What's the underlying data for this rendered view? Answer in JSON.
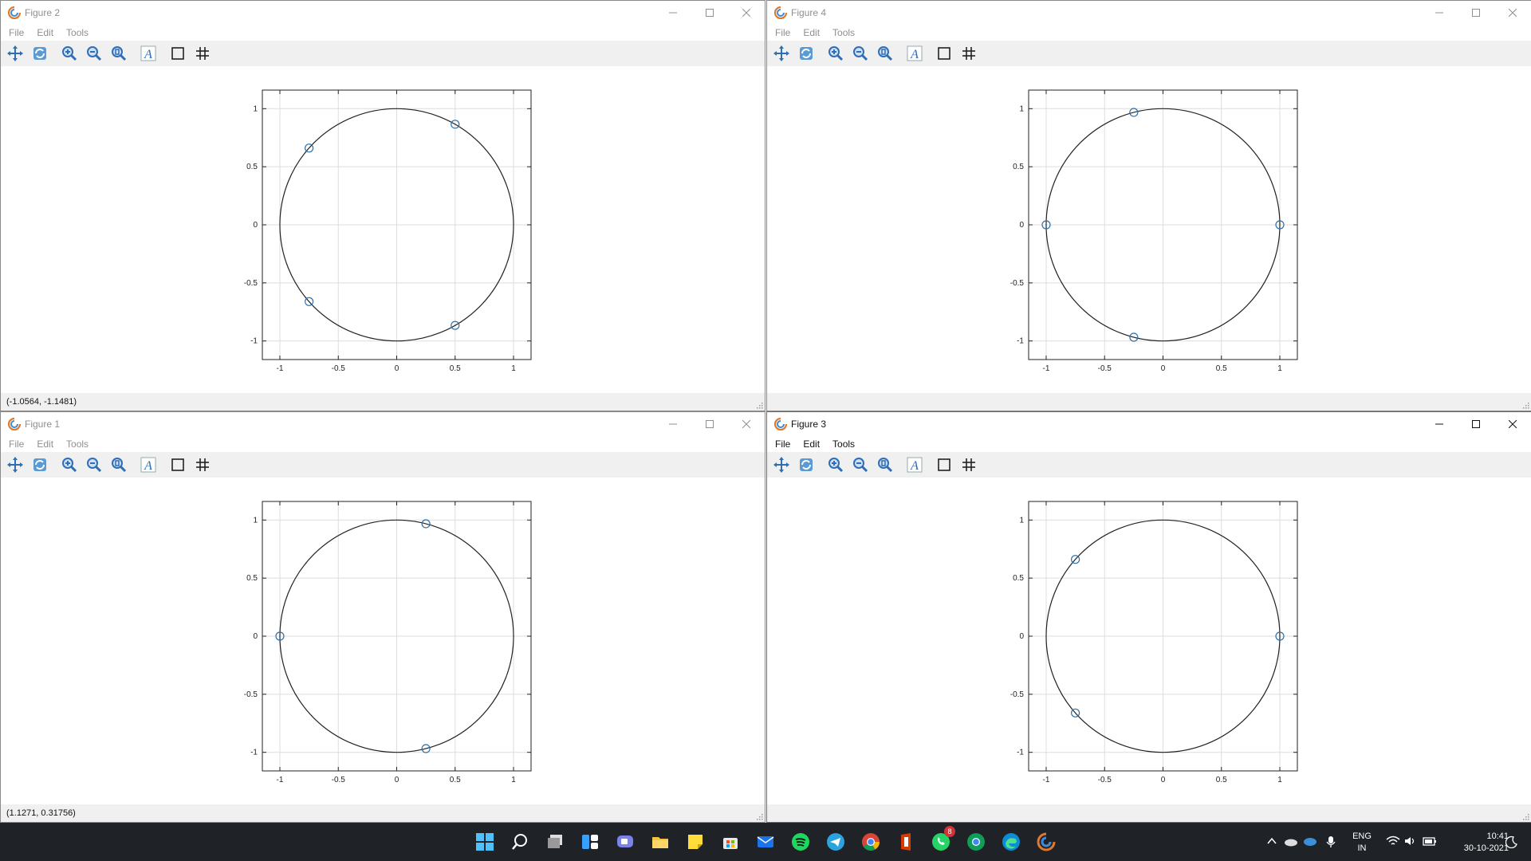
{
  "windows": [
    {
      "title": "Figure 2",
      "menus": [
        "File",
        "Edit",
        "Tools"
      ],
      "status": "(-1.0564, -1.1481)",
      "active": false,
      "points": [
        [
          0.5,
          0.866
        ],
        [
          -0.75,
          0.661
        ],
        [
          -0.75,
          -0.661
        ],
        [
          0.5,
          -0.866
        ]
      ]
    },
    {
      "title": "Figure 4",
      "menus": [
        "File",
        "Edit",
        "Tools"
      ],
      "status": "",
      "active": false,
      "points": [
        [
          -0.25,
          0.968
        ],
        [
          -1,
          0
        ],
        [
          1,
          0
        ],
        [
          -0.25,
          -0.968
        ]
      ]
    },
    {
      "title": "Figure 1",
      "menus": [
        "File",
        "Edit",
        "Tools"
      ],
      "status": "(1.1271, 0.31756)",
      "active": false,
      "points": [
        [
          0.25,
          0.968
        ],
        [
          -1,
          0
        ],
        [
          0.25,
          -0.968
        ]
      ]
    },
    {
      "title": "Figure 3",
      "menus": [
        "File",
        "Edit",
        "Tools"
      ],
      "status": "",
      "active": true,
      "points": [
        [
          -0.75,
          0.661
        ],
        [
          1,
          0
        ],
        [
          -0.75,
          -0.661
        ]
      ]
    }
  ],
  "chart_data": [
    {
      "type": "scatter",
      "title": "",
      "xlabel": "",
      "ylabel": "",
      "xlim": [
        -1.15,
        1.15
      ],
      "ylim": [
        -1.16,
        1.16
      ],
      "xticks": [
        "-1",
        "-0.5",
        "0",
        "0.5",
        "1"
      ],
      "yticks": [
        "1",
        "0.5",
        "0",
        "-0.5",
        "-1"
      ],
      "grid": true,
      "reference_curve": "unit circle",
      "series": [
        {
          "x": [
            0.5,
            -0.75,
            -0.75,
            0.5
          ],
          "y": [
            0.866,
            0.661,
            -0.661,
            -0.866
          ]
        }
      ]
    },
    {
      "type": "scatter",
      "title": "",
      "xlabel": "",
      "ylabel": "",
      "xlim": [
        -1.15,
        1.15
      ],
      "ylim": [
        -1.16,
        1.16
      ],
      "xticks": [
        "-1",
        "-0.5",
        "0",
        "0.5",
        "1"
      ],
      "yticks": [
        "1",
        "0.5",
        "0",
        "-0.5",
        "-1"
      ],
      "grid": true,
      "reference_curve": "unit circle",
      "series": [
        {
          "x": [
            -0.25,
            -1,
            1,
            -0.25
          ],
          "y": [
            0.968,
            0,
            0,
            -0.968
          ]
        }
      ]
    },
    {
      "type": "scatter",
      "title": "",
      "xlabel": "",
      "ylabel": "",
      "xlim": [
        -1.15,
        1.15
      ],
      "ylim": [
        -1.16,
        1.16
      ],
      "xticks": [
        "-1",
        "-0.5",
        "0",
        "0.5",
        "1"
      ],
      "yticks": [
        "1",
        "0.5",
        "0",
        "-0.5",
        "-1"
      ],
      "grid": true,
      "reference_curve": "unit circle",
      "series": [
        {
          "x": [
            0.25,
            -1,
            0.25
          ],
          "y": [
            0.968,
            0,
            -0.968
          ]
        }
      ]
    },
    {
      "type": "scatter",
      "title": "",
      "xlabel": "",
      "ylabel": "",
      "xlim": [
        -1.15,
        1.15
      ],
      "ylim": [
        -1.16,
        1.16
      ],
      "xticks": [
        "-1",
        "-0.5",
        "0",
        "0.5",
        "1"
      ],
      "yticks": [
        "1",
        "0.5",
        "0",
        "-0.5",
        "-1"
      ],
      "grid": true,
      "reference_curve": "unit circle",
      "series": [
        {
          "x": [
            -0.75,
            1,
            -0.75
          ],
          "y": [
            0.661,
            0,
            -0.661
          ]
        }
      ]
    }
  ],
  "colors": {
    "marker": "#2e6fa8",
    "circle": "#222222",
    "grid": "#dddddd",
    "toolbar": "#f0f0f0",
    "taskbar": "#1f2227"
  },
  "taskbar": {
    "apps": [
      "start-icon",
      "search-icon",
      "task-view-icon",
      "widgets-icon",
      "chat-icon",
      "file-explorer-icon",
      "sticky-notes-icon",
      "store-icon",
      "mail-icon",
      "spotify-icon",
      "telegram-icon",
      "chrome-icon",
      "office-icon",
      "whatsapp-icon",
      "chrome-profile-icon",
      "edge-icon",
      "octave-icon"
    ],
    "whatsapp_badge": "8",
    "lang_line1": "ENG",
    "lang_line2": "IN",
    "time": "10:41",
    "date": "30-10-2021"
  }
}
